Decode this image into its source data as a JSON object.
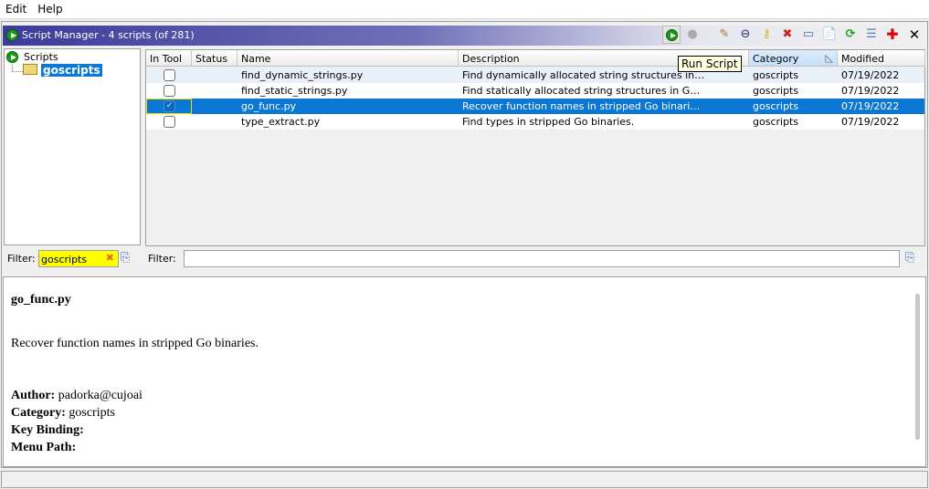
{
  "menu": [
    "Edit",
    "Help"
  ],
  "title": "Script Manager - 4 scripts  (of 281)",
  "toolbar": {
    "tooltip": "Run Script",
    "icons": [
      "run-script-icon",
      "run-last-icon",
      "edit-script-icon",
      "eclipse-icon",
      "key-binding-icon",
      "delete-icon",
      "rename-icon",
      "new-script-icon",
      "refresh-icon",
      "script-directories-icon",
      "help-icon",
      "close-icon"
    ]
  },
  "tree": {
    "root": "Scripts",
    "child": "goscripts"
  },
  "columns": [
    "In Tool",
    "Status",
    "Name",
    "Description",
    "Category",
    "Modified"
  ],
  "rows": [
    {
      "in_tool": false,
      "status": "",
      "name": "find_dynamic_strings.py",
      "description": "Find dynamically allocated string structures in…",
      "category": "goscripts",
      "modified": "07/19/2022"
    },
    {
      "in_tool": false,
      "status": "",
      "name": "find_static_strings.py",
      "description": "Find statically allocated string structures in G…",
      "category": "goscripts",
      "modified": "07/19/2022"
    },
    {
      "in_tool": true,
      "status": "",
      "name": "go_func.py",
      "description": "Recover function names in stripped Go binari…",
      "category": "goscripts",
      "modified": "07/19/2022",
      "selected": true
    },
    {
      "in_tool": false,
      "status": "",
      "name": "type_extract.py",
      "description": "Find types in stripped Go binaries.",
      "category": "goscripts",
      "modified": "07/19/2022"
    }
  ],
  "tree_filter": {
    "label": "Filter:",
    "value": "goscripts"
  },
  "table_filter": {
    "label": "Filter:",
    "value": ""
  },
  "detail": {
    "name": "go_func.py",
    "description": "Recover function names in stripped Go binaries.",
    "author_label": "Author:",
    "author": " padorka@cujoai",
    "category_label": "Category:",
    "category": " goscripts",
    "keybinding_label": "Key Binding:",
    "menupath_label": "Menu Path:"
  },
  "colors": {
    "selection": "#0a78d4",
    "filter_highlight": "#ffff00"
  }
}
